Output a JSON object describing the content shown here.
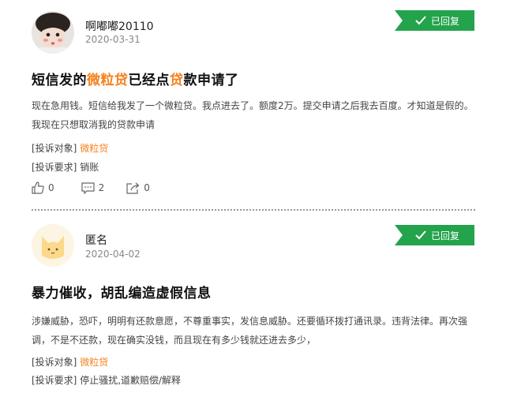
{
  "posts": [
    {
      "user": "啊嘟嘟20110",
      "date": "2020-03-31",
      "badge": "已回复",
      "title": {
        "p1": "短信发的",
        "h1": "微粒贷",
        "p2": "已经点",
        "h2": "贷",
        "p3": "款申请了"
      },
      "content": "现在急用钱。短信给我发了一个微粒贷。我点进去了。额度2万。提交申请之后我去百度。才知道是假的。我现在只想取消我的贷款申请",
      "target_label": "[投诉对象]",
      "target_value": "微粒贷",
      "request_label": "[投诉要求]",
      "request_value": "销账",
      "likes": "0",
      "comments": "2",
      "shares": "0"
    },
    {
      "user": "匿名",
      "date": "2020-04-02",
      "badge": "已回复",
      "title": "暴力催收，胡乱编造虚假信息",
      "content": "涉嫌威胁，恐吓，明明有还款意愿，不尊重事实，发信息威胁。还要循环拨打通讯录。违背法律。再次强调，不是不还款，现在确实没钱，而且现在有多少钱就还进去多少，",
      "target_label": "[投诉对象]",
      "target_value": "微粒贷",
      "request_label": "[投诉要求]",
      "request_value": "停止骚扰,道歉赔偿/解释"
    }
  ],
  "colors": {
    "accent": "#f5821f",
    "badge": "#23a34b"
  },
  "icons": {
    "like": "thumbs-up-icon",
    "comment": "comment-icon",
    "share": "share-icon",
    "check": "check-icon"
  }
}
